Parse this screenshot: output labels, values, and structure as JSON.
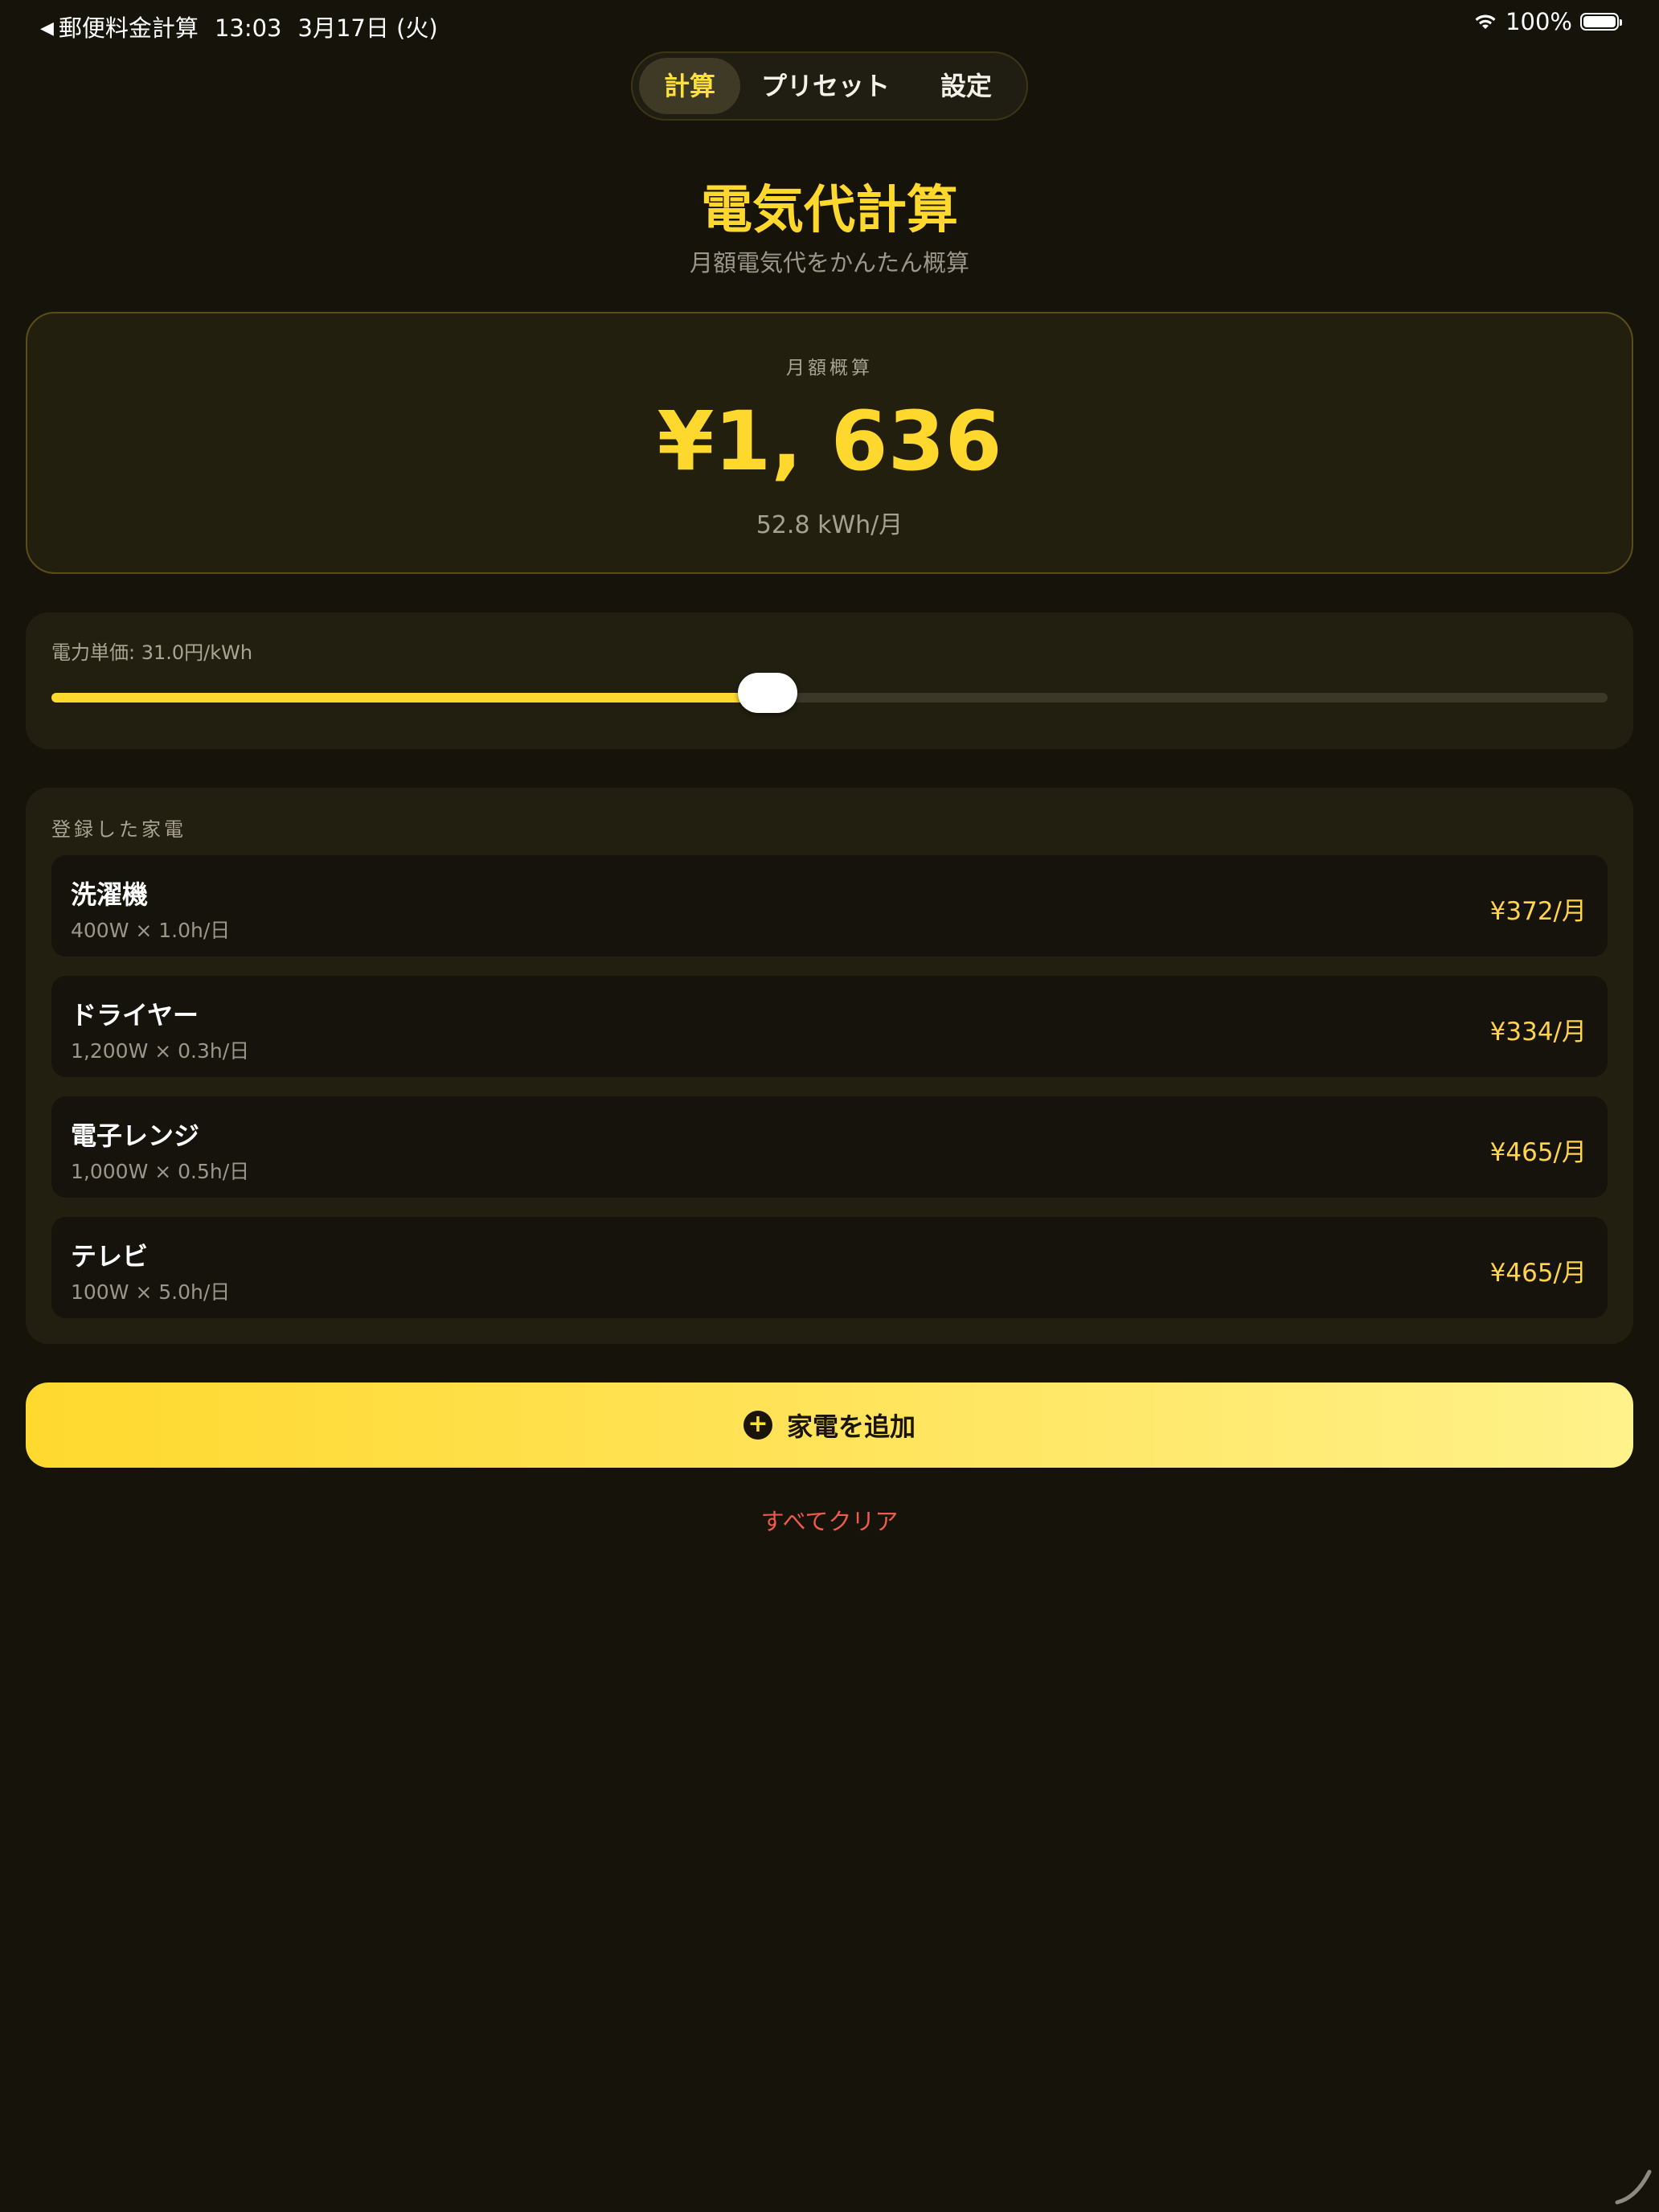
{
  "status_bar": {
    "back_app": "郵便料金計算",
    "time": "13:03",
    "date": "3月17日 (火)",
    "battery": "100%"
  },
  "tabs": [
    {
      "label": "計算",
      "active": true
    },
    {
      "label": "プリセット",
      "active": false
    },
    {
      "label": "設定",
      "active": false
    }
  ],
  "header": {
    "title": "電気代計算",
    "subtitle": "月額電気代をかんたん概算"
  },
  "summary": {
    "label": "月額概算",
    "amount": "¥1, 636",
    "kwh": "52.8 kWh/月"
  },
  "rate": {
    "label": "電力単価: 31.0円/kWh",
    "slider_fraction": 0.46
  },
  "appliances": {
    "header": "登録した家電",
    "items": [
      {
        "name": "洗濯機",
        "detail": "400W × 1.0h/日",
        "cost": "¥372/月"
      },
      {
        "name": "ドライヤー",
        "detail": "1,200W × 0.3h/日",
        "cost": "¥334/月"
      },
      {
        "name": "電子レンジ",
        "detail": "1,000W × 0.5h/日",
        "cost": "¥465/月"
      },
      {
        "name": "テレビ",
        "detail": "100W × 5.0h/日",
        "cost": "¥465/月"
      }
    ]
  },
  "add_button": {
    "label": "家電を追加",
    "icon": "plus-circle-icon"
  },
  "clear_button": {
    "label": "すべてクリア"
  },
  "colors": {
    "accent": "#ffd82e",
    "background": "#16140a",
    "danger": "#f05a4c"
  }
}
